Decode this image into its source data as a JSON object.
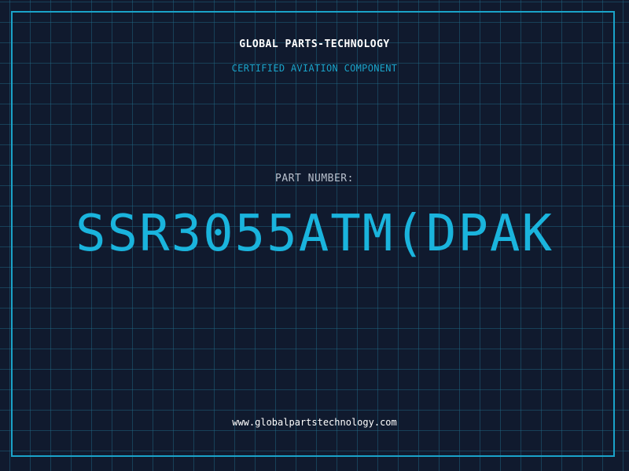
{
  "header": {
    "company": "GLOBAL PARTS-TECHNOLOGY",
    "subtitle": "CERTIFIED AVIATION COMPONENT"
  },
  "part": {
    "label": "PART NUMBER:",
    "number": "SSR3055ATM(DPAK"
  },
  "footer": {
    "website": "www.globalpartstechnology.com"
  },
  "colors": {
    "background": "#101a2e",
    "accent": "#1aa3c9",
    "part_number": "#1ab4dd",
    "text": "#ffffff",
    "label": "#b8c0cc"
  }
}
